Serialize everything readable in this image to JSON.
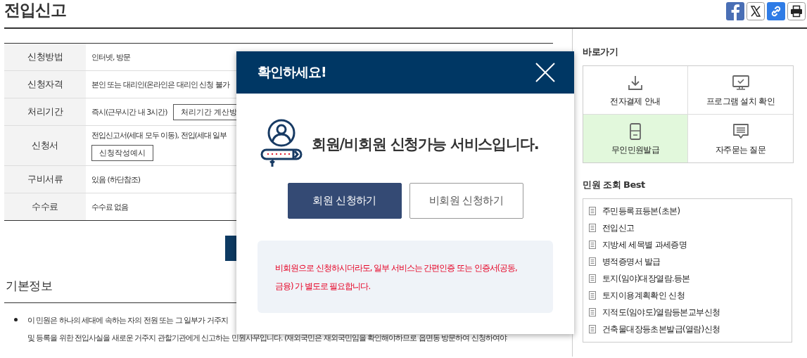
{
  "page": {
    "title": "전입신고"
  },
  "share_buttons": [
    {
      "kind": "facebook"
    },
    {
      "kind": "x"
    },
    {
      "kind": "link"
    },
    {
      "kind": "print"
    }
  ],
  "info_table": {
    "rows": [
      {
        "label": "신청방법",
        "value": "인터넷, 방문"
      },
      {
        "label": "신청자격",
        "value": "본인 또는 대리인(온라인은 대리인 신청 불가"
      },
      {
        "label": "처리기간",
        "value": "즉시(근무시간 내 3시간)",
        "button": "처리기간 계산방"
      },
      {
        "label": "신청서",
        "value": "전입신고서(세대 모두 이동), 전입(세대 일부",
        "button": "신청작성예시",
        "button_below": true
      },
      {
        "label": "구비서류",
        "value": "있음 (하단참조)"
      },
      {
        "label": "수수료",
        "value": "수수료 없음"
      }
    ]
  },
  "section": {
    "title": "기본정보",
    "bullets": [
      {
        "lines": [
          "이 민원은 하나의 세대에 속하는 자의 전원 또는 그 일부가 거주지",
          "및 등록을 위한 전입사실을 새로운 거주지 관할기관에게 신고하는 민원사무입니다. (재외국민은 재외국민임을 확인해야하므로 읍면동 방문하여 신청하여야"
        ]
      }
    ]
  },
  "sidebar": {
    "quick_title": "바로가기",
    "quick_links": [
      {
        "label": "전자결제 안내",
        "kind": "download",
        "selected": false
      },
      {
        "label": "프로그램 설치 확인",
        "kind": "monitor",
        "selected": false
      },
      {
        "label": "무인민원발급",
        "kind": "kiosk",
        "selected": true
      },
      {
        "label": "자주묻는 질문",
        "kind": "chat",
        "selected": false
      }
    ],
    "best_title": "민원 조회 Best",
    "best_items": [
      "주민등록표등본(초본)",
      "전입신고",
      "지방세 세목별 과세증명",
      "병적증명서 발급",
      "토지(임야)대장열람.등본",
      "토지이용계획확인 신청",
      "지적도(임야도)열람등본교부신청",
      "건축물대장등초본발급(열람)신청"
    ]
  },
  "modal": {
    "title": "확인하세요!",
    "message": "회원/비회원 신청가능 서비스입니다.",
    "buttons": [
      {
        "label": "회원 신청하기",
        "primary": true
      },
      {
        "label": "비회원 신청하기",
        "primary": false
      }
    ],
    "notice": "비회원으로 신청하시더라도, 일부 서비스는 간편인증 또는 인증서(공동, 금융) 가 별도로 필요합니다."
  }
}
